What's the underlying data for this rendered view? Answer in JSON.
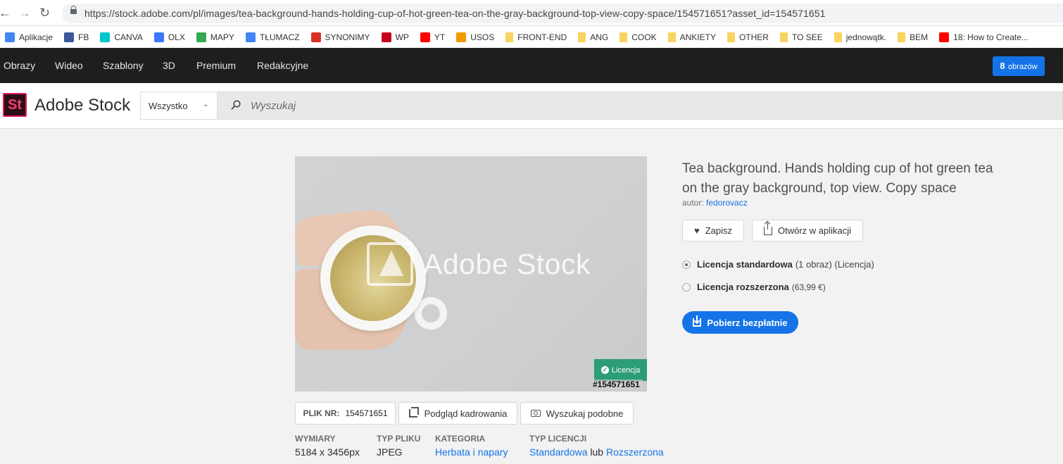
{
  "browser": {
    "url": "https://stock.adobe.com/pl/images/tea-background-hands-holding-cup-of-hot-green-tea-on-the-gray-background-top-view-copy-space/154571651?asset_id=154571651"
  },
  "bookmarks": [
    {
      "label": "Aplikacje",
      "icon": "apps-grid-icon",
      "color": "#4285f4"
    },
    {
      "label": "FB",
      "icon": "facebook-icon",
      "color": "#3b5998"
    },
    {
      "label": "CANVA",
      "icon": "canva-icon",
      "color": "#00c4cc"
    },
    {
      "label": "OLX",
      "icon": "olx-icon",
      "color": "#3a77ff"
    },
    {
      "label": "MAPY",
      "icon": "maps-icon",
      "color": "#34a853"
    },
    {
      "label": "TŁUMACZ",
      "icon": "translate-icon",
      "color": "#4285f4"
    },
    {
      "label": "SYNONIMY",
      "icon": "synonimy-icon",
      "color": "#d93025"
    },
    {
      "label": "WP",
      "icon": "wp-icon",
      "color": "#c4001a"
    },
    {
      "label": "YT",
      "icon": "youtube-icon",
      "color": "#ff0000"
    },
    {
      "label": "USOS",
      "icon": "usos-icon",
      "color": "#f29900"
    },
    {
      "label": "FRONT-END",
      "icon": "folder-icon",
      "color": "#f6d45d"
    },
    {
      "label": "ANG",
      "icon": "folder-icon",
      "color": "#f6d45d"
    },
    {
      "label": "COOK",
      "icon": "folder-icon",
      "color": "#f6d45d"
    },
    {
      "label": "ANKIETY",
      "icon": "folder-icon",
      "color": "#f6d45d"
    },
    {
      "label": "OTHER",
      "icon": "folder-icon",
      "color": "#f6d45d"
    },
    {
      "label": "TO SEE",
      "icon": "folder-icon",
      "color": "#f6d45d"
    },
    {
      "label": "jednowątk.",
      "icon": "folder-icon",
      "color": "#f6d45d"
    },
    {
      "label": "BEM",
      "icon": "folder-icon",
      "color": "#f6d45d"
    },
    {
      "label": "18: How to Create...",
      "icon": "youtube-icon",
      "color": "#ff0000"
    }
  ],
  "nav": {
    "items": [
      "Obrazy",
      "Wideo",
      "Szablony",
      "3D",
      "Premium",
      "Redakcyjne"
    ],
    "cart_count": "8",
    "cart_label": "obrazów"
  },
  "header": {
    "logo_text": "St",
    "brand": "Adobe Stock",
    "search_scope": "Wszystko",
    "search_placeholder": "Wyszukaj"
  },
  "asset": {
    "watermark": "Adobe Stock",
    "license_badge": "Licencja",
    "id_tag": "#154571651",
    "title": "Tea background. Hands holding cup of hot green tea on the gray background, top view. Copy space",
    "author_label": "autor:",
    "author": "fedorovacz",
    "save_label": "Zapisz",
    "open_app_label": "Otwórz w aplikacji",
    "plik_label": "PLIK NR:",
    "plik_value": "154571651",
    "crop_label": "Podgląd kadrowania",
    "similar_label": "Wyszukaj podobne",
    "download_label": "Pobierz bezpłatnie"
  },
  "licenses": [
    {
      "name": "Licencja standardowa",
      "note": "(1 obraz)",
      "extra": "(Licencja)",
      "selected": true
    },
    {
      "name": "Licencja rozszerzona",
      "note": "(63,99 €)",
      "extra": "",
      "selected": false
    }
  ],
  "details": {
    "dims_h": "WYMIARY",
    "dims_v": "5184 x 3456px",
    "type_h": "TYP PLIKU",
    "type_v": "JPEG",
    "cat_h": "KATEGORIA",
    "cat_v": "Herbata i napary",
    "lic_h": "TYP LICENCJI",
    "lic_v1": "Standardowa",
    "lic_or": "lub",
    "lic_v2": "Rozszerzona"
  },
  "colors": {
    "accent": "#1473e6",
    "license_green": "#2d9d78",
    "nav_bg": "#1e1e1e"
  }
}
